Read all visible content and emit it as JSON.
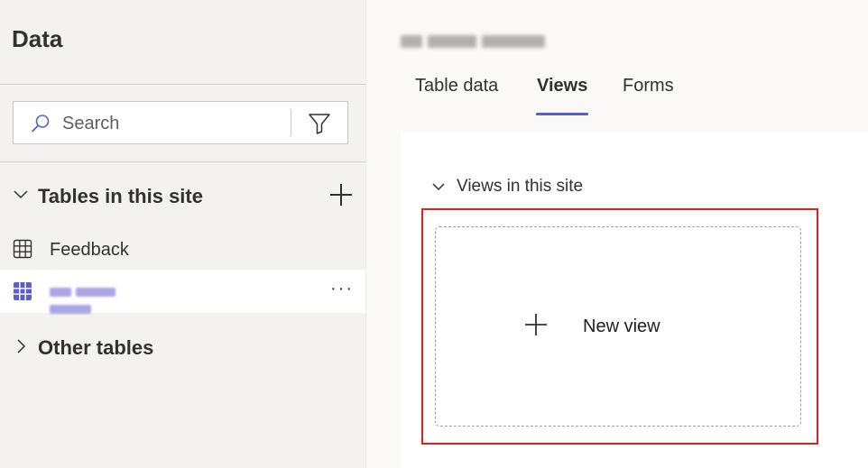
{
  "sidebar": {
    "title": "Data",
    "search": {
      "placeholder": "Search"
    },
    "tables_section": {
      "label": "Tables in this site",
      "items": [
        {
          "label": "Feedback",
          "icon": "table-grid-icon",
          "selected": false
        },
        {
          "label": "",
          "icon": "table-grid-icon",
          "selected": true
        }
      ]
    },
    "other_section": {
      "label": "Other tables"
    }
  },
  "main": {
    "tabs": [
      {
        "label": "Table data",
        "active": false
      },
      {
        "label": "Views",
        "active": true
      },
      {
        "label": "Forms",
        "active": false
      }
    ],
    "views_section": {
      "label": "Views in this site"
    },
    "new_view": {
      "label": "New view"
    }
  },
  "colors": {
    "accent": "#5b5fc7",
    "highlight_border": "#e02020",
    "panel_bg": "#f3f2f1"
  }
}
